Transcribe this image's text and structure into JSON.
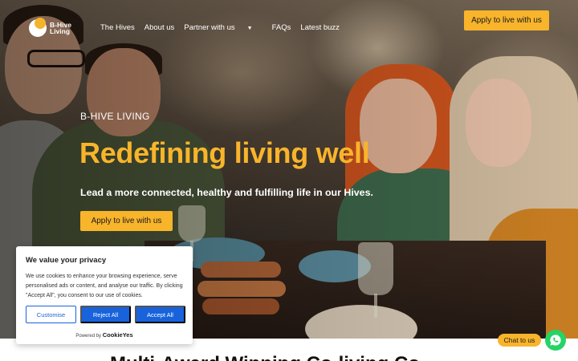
{
  "header": {
    "logo_text_line1": "B-Hive",
    "logo_text_line2": "Living",
    "nav": [
      {
        "label": "The Hives"
      },
      {
        "label": "About us"
      },
      {
        "label": "Partner with us"
      },
      {
        "label": "FAQs"
      },
      {
        "label": "Latest buzz"
      }
    ],
    "cta_label": "Apply to live with us"
  },
  "hero": {
    "eyebrow": "B-HIVE LIVING",
    "headline": "Redefining living well",
    "subheadline": "Lead a more connected, healthy and fulfilling life in our Hives.",
    "cta_label": "Apply to live with us"
  },
  "cookie_banner": {
    "title": "We value your privacy",
    "body": "We use cookies to enhance your browsing experience, serve personalised ads or content, and analyse our traffic. By clicking \"Accept All\", you consent to our use of cookies.",
    "buttons": {
      "customise": "Customise",
      "reject": "Reject All",
      "accept": "Accept All"
    },
    "powered_by": "Powered by",
    "brand": "CookieYes"
  },
  "chat": {
    "label": "Chat to us",
    "icon": "whatsapp-icon"
  },
  "section": {
    "heading": "Multi-Award Winning Co-living Co..."
  },
  "colors": {
    "accent": "#f8b42b",
    "cookie_blue": "#1863dc",
    "chat_green": "#25d366"
  }
}
